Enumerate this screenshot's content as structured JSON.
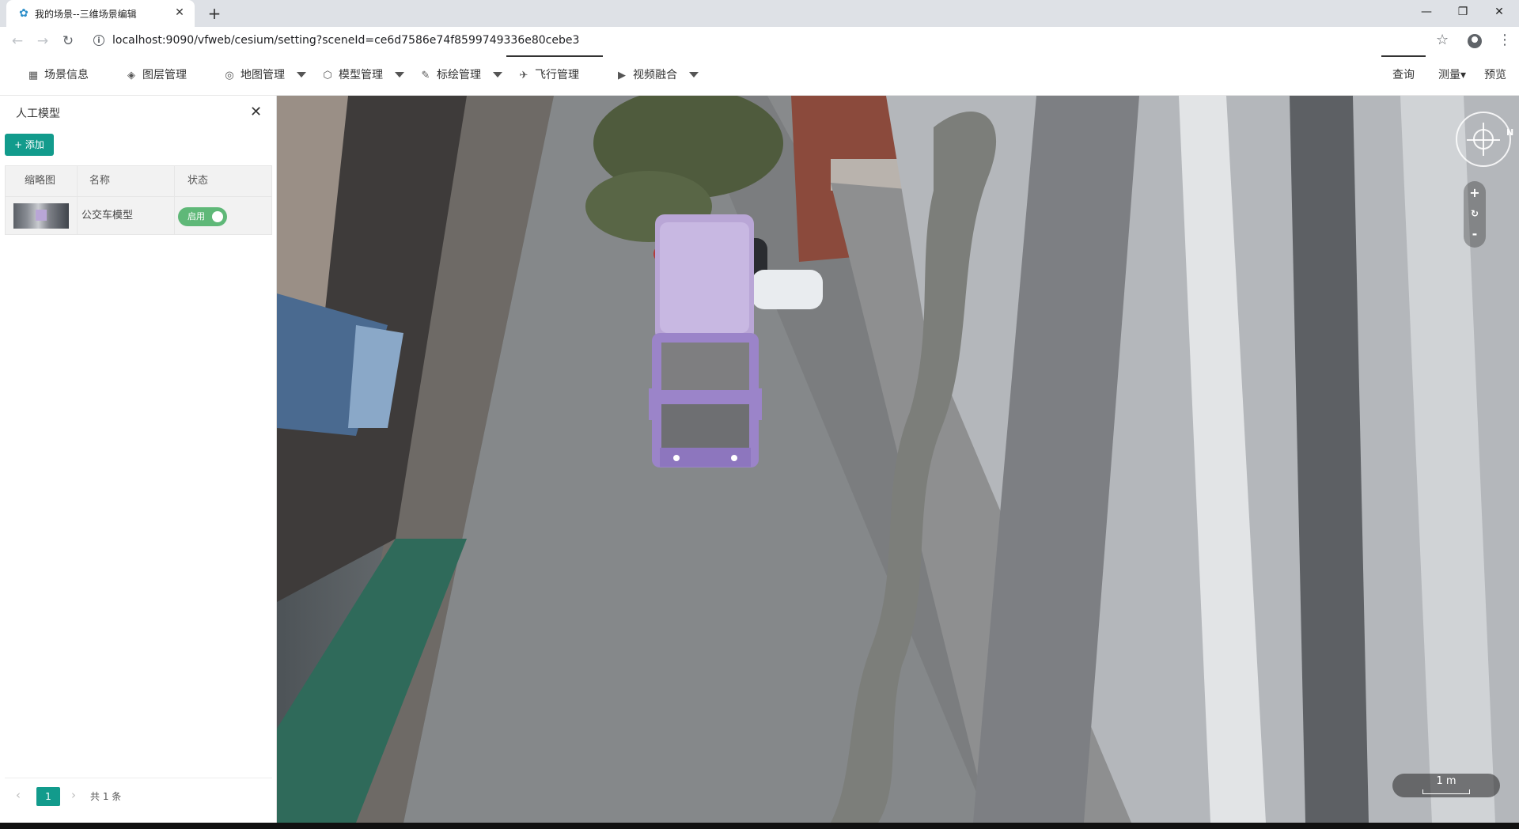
{
  "browser": {
    "tab_title": "我的场景--三维场景编辑",
    "url": "localhost:9090/vfweb/cesium/setting?sceneId=ce6d7586e74f8599749336e80cebe3",
    "new_tab_symbol": "+",
    "minimize_symbol": "—",
    "restore_symbol": "❐",
    "close_symbol": "✕",
    "back_symbol": "←",
    "forward_symbol": "→",
    "reload_symbol": "↻",
    "star_symbol": "☆",
    "menu_symbol": "⋮",
    "info_symbol": "i"
  },
  "toolbar": {
    "items": [
      {
        "label": "场景信息",
        "icon": "scene-info-icon",
        "glyph": "▦"
      },
      {
        "label": "图层管理",
        "icon": "layers-icon",
        "glyph": "◈"
      },
      {
        "label": "地图管理",
        "icon": "globe-icon",
        "glyph": "◎"
      },
      {
        "label": "模型管理",
        "icon": "cube-icon",
        "glyph": "⬡"
      },
      {
        "label": "标绘管理",
        "icon": "pencil-icon",
        "glyph": "✎"
      },
      {
        "label": "飞行管理",
        "icon": "paper-plane-icon",
        "glyph": "✈"
      },
      {
        "label": "视频融合",
        "icon": "video-icon",
        "glyph": "▶"
      }
    ],
    "query": "查询",
    "measure": "测量▾",
    "preview": "预览"
  },
  "panel": {
    "title": "人工模型",
    "close_symbol": "✕",
    "add_button": "+ 添加",
    "columns": [
      "缩略图",
      "名称",
      "状态"
    ],
    "rows": [
      {
        "name": "公交车模型",
        "status": "启用"
      }
    ],
    "pagination": {
      "prev": "‹",
      "next": "›",
      "current": "1",
      "total": "共 1 条"
    }
  },
  "map": {
    "compass_north": "N",
    "zoom_in": "+",
    "reset": "↻",
    "zoom_out": "-",
    "scale_label": "1 m"
  },
  "colors": {
    "accent": "#129b8c",
    "switch_on": "#5fb878",
    "bus_roof": "#b9a6d6",
    "bus_body": "#9b84c9"
  }
}
